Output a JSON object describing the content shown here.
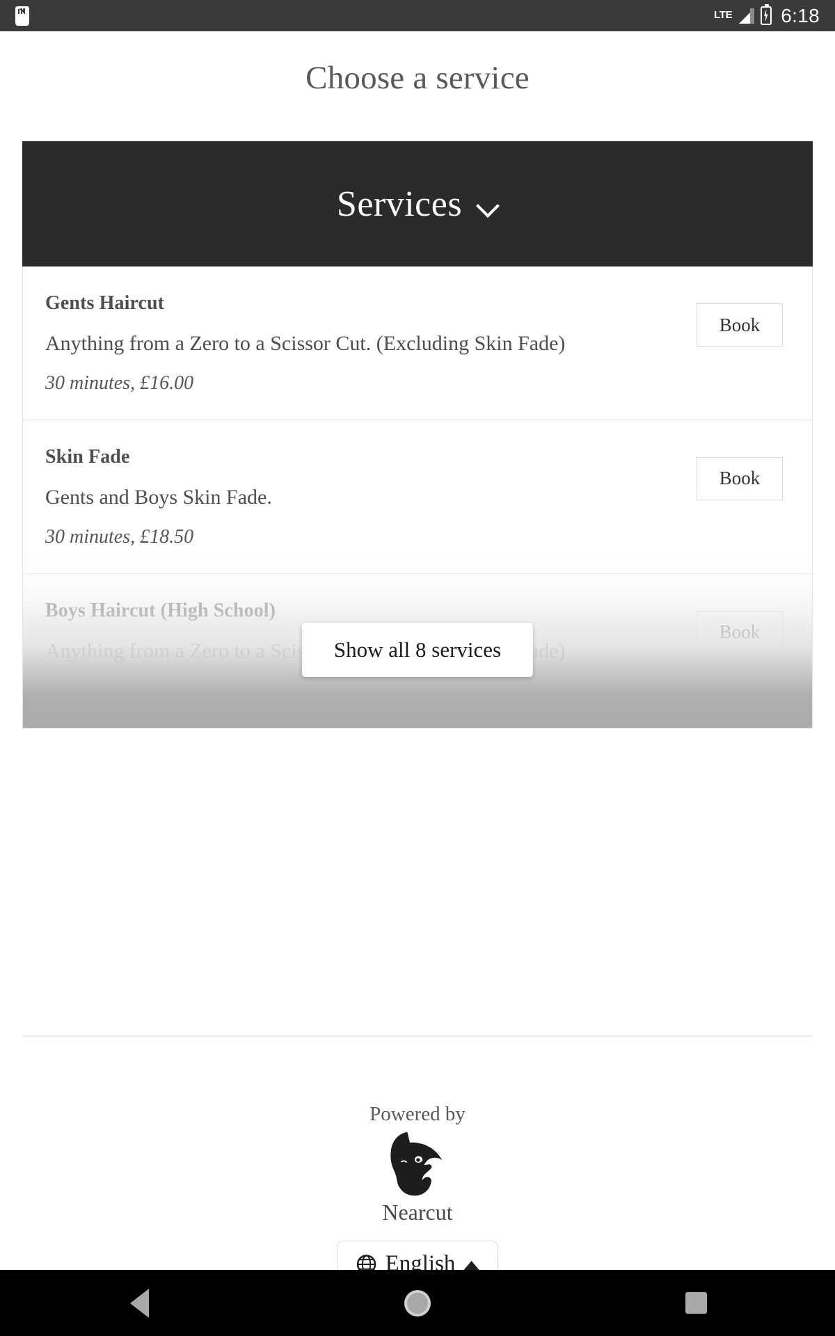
{
  "status_bar": {
    "sdcard_icon": "sdcard-icon",
    "network_label": "LTE",
    "signal_icon": "signal-bars-icon",
    "battery_icon": "battery-charging-icon",
    "time": "6:18"
  },
  "page": {
    "title": "Choose a service"
  },
  "services_card": {
    "header": {
      "label": "Services",
      "chevron_icon": "chevron-down-icon"
    },
    "items": [
      {
        "name": "Gents Haircut",
        "description": "Anything from a Zero to a Scissor Cut. (Excluding Skin Fade)",
        "meta": "30 minutes, £16.00",
        "book_label": "Book"
      },
      {
        "name": "Skin Fade",
        "description": "Gents and Boys Skin Fade.",
        "meta": "30 minutes, £18.50",
        "book_label": "Book"
      },
      {
        "name": "Boys Haircut (High School)",
        "description": "Anything from a Zero to a Scissor Cut. (Excluding Skin Fade)",
        "meta": "30 minutes, £13.00",
        "book_label": "Book"
      }
    ],
    "show_all_label": "Show all 8 services"
  },
  "footer": {
    "powered_by": "Powered by",
    "brand_logo_icon": "bearded-man-logo-icon",
    "brand_name": "Nearcut"
  },
  "language_selector": {
    "globe_icon": "globe-icon",
    "label": "English",
    "caret_icon": "caret-up-icon"
  },
  "nav_bar": {
    "back_icon": "back-triangle-icon",
    "home_icon": "home-circle-icon",
    "recents_icon": "recents-square-icon"
  },
  "colors": {
    "status_bar_bg": "#3a3a3a",
    "card_header_bg": "#2b2b2b",
    "text_primary": "#4e4e4e",
    "page_bg": "#ffffff",
    "nav_bar_bg": "#000000"
  }
}
